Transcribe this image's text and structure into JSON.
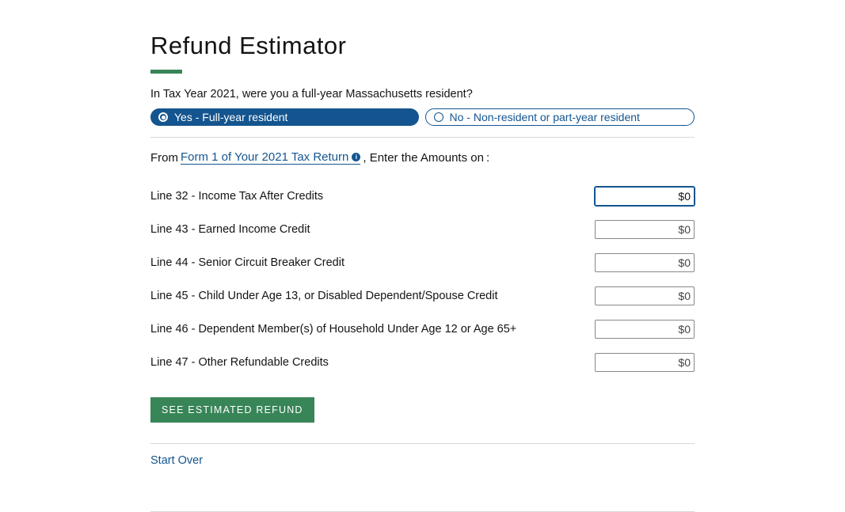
{
  "title": "Refund Estimator",
  "question": "In Tax Year 2021, were you a full-year Massachusetts resident?",
  "radios": {
    "yes": "Yes - Full-year resident",
    "no": "No - Non-resident or part-year resident"
  },
  "from_prefix": "From",
  "form_link": "Form 1 of Your 2021 Tax Return",
  "from_suffix": ", Enter the Amounts on",
  "from_colon": ":",
  "fields": [
    {
      "label": "Line 32 - Income Tax After Credits",
      "value": "$0",
      "active": true
    },
    {
      "label": "Line 43 - Earned Income Credit",
      "value": "$0",
      "active": false
    },
    {
      "label": "Line 44 - Senior Circuit Breaker Credit",
      "value": "$0",
      "active": false
    },
    {
      "label": "Line 45 - Child Under Age 13, or Disabled Dependent/Spouse Credit",
      "value": "$0",
      "active": false
    },
    {
      "label": "Line 46 - Dependent Member(s) of Household Under Age 12 or Age 65+",
      "value": "$0",
      "active": false
    },
    {
      "label": "Line 47 - Other Refundable Credits",
      "value": "$0",
      "active": false
    }
  ],
  "submit": "SEE ESTIMATED REFUND",
  "start_over": "Start Over",
  "info_glyph": "i"
}
